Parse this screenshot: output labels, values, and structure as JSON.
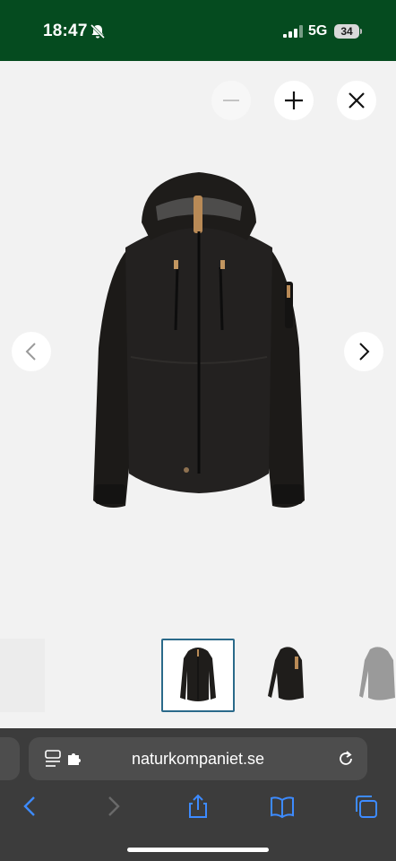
{
  "status_bar": {
    "time": "18:47",
    "network": "5G",
    "battery": "34",
    "icons": [
      "bell-slash-icon",
      "signal-icon"
    ]
  },
  "viewer": {
    "controls": [
      {
        "name": "zoom-out",
        "icon": "minus-icon",
        "enabled": false
      },
      {
        "name": "zoom-in",
        "icon": "plus-icon",
        "enabled": true
      },
      {
        "name": "close",
        "icon": "close-icon",
        "enabled": true
      }
    ],
    "navigation": [
      "chevron-left-icon",
      "chevron-right-icon"
    ],
    "image": "black-hooded-shell-jacket-front"
  },
  "thumbnails": [
    {
      "view": "front",
      "selected": true
    },
    {
      "view": "side",
      "selected": false
    },
    {
      "view": "grey-variant",
      "selected": false
    }
  ],
  "browser": {
    "url": "naturkompaniet.se",
    "toolbar_icons": [
      "back-icon",
      "forward-icon",
      "share-icon",
      "bookmarks-icon",
      "tabs-icon"
    ]
  },
  "colors": {
    "status_bar": "#054b1f",
    "browser_bar": "#3c3c3c",
    "accent_blue": "#3d8bff",
    "selected_thumb_border": "#2b6a8a"
  }
}
